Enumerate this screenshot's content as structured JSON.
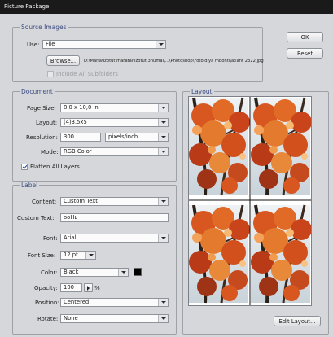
{
  "window": {
    "title": "Picture Package"
  },
  "source_images": {
    "legend": "Source Images",
    "use_label": "Use:",
    "use_value": "File",
    "browse_label": "Browse...",
    "path": "D:\\Maria\\Izotut maratal\\Izotut 3numal\\...\\Photoshop\\Foto dlya mbonti\\atlant 2322.jpg",
    "include_subfolders_label": "Include All Subfolders"
  },
  "buttons": {
    "ok": "OK",
    "reset": "Reset",
    "edit_layout": "Edit Layout..."
  },
  "document": {
    "legend": "Document",
    "page_size_label": "Page Size:",
    "page_size_value": "8,0 x 10,0 in",
    "layout_label": "Layout:",
    "layout_value": "(4)3.5x5",
    "resolution_label": "Resolution:",
    "resolution_value": "300",
    "resolution_unit": "pixels/inch",
    "mode_label": "Mode:",
    "mode_value": "RGB Color",
    "flatten_label": "Flatten All Layers",
    "flatten_checked": true
  },
  "label": {
    "legend": "Label",
    "content_label": "Content:",
    "content_value": "Custom Text",
    "custom_text_label": "Custom Text:",
    "custom_text_value": "ooHь",
    "font_label": "Font:",
    "font_value": "Arial",
    "font_size_label": "Font Size:",
    "font_size_value": "12 pt",
    "color_label": "Color:",
    "color_value": "Black",
    "color_swatch": "#000000",
    "opacity_label": "Opacity:",
    "opacity_value": "100",
    "opacity_unit": "%",
    "position_label": "Position:",
    "position_value": "Centered",
    "rotate_label": "Rotate:",
    "rotate_value": "None"
  },
  "layout_panel": {
    "legend": "Layout",
    "photo_count": 4
  },
  "colors": {
    "legend_text": "#3d4d82",
    "titlebar": "#1a1a1a",
    "leaf_orange": "#d8561f",
    "sky": "#e9eef2"
  }
}
